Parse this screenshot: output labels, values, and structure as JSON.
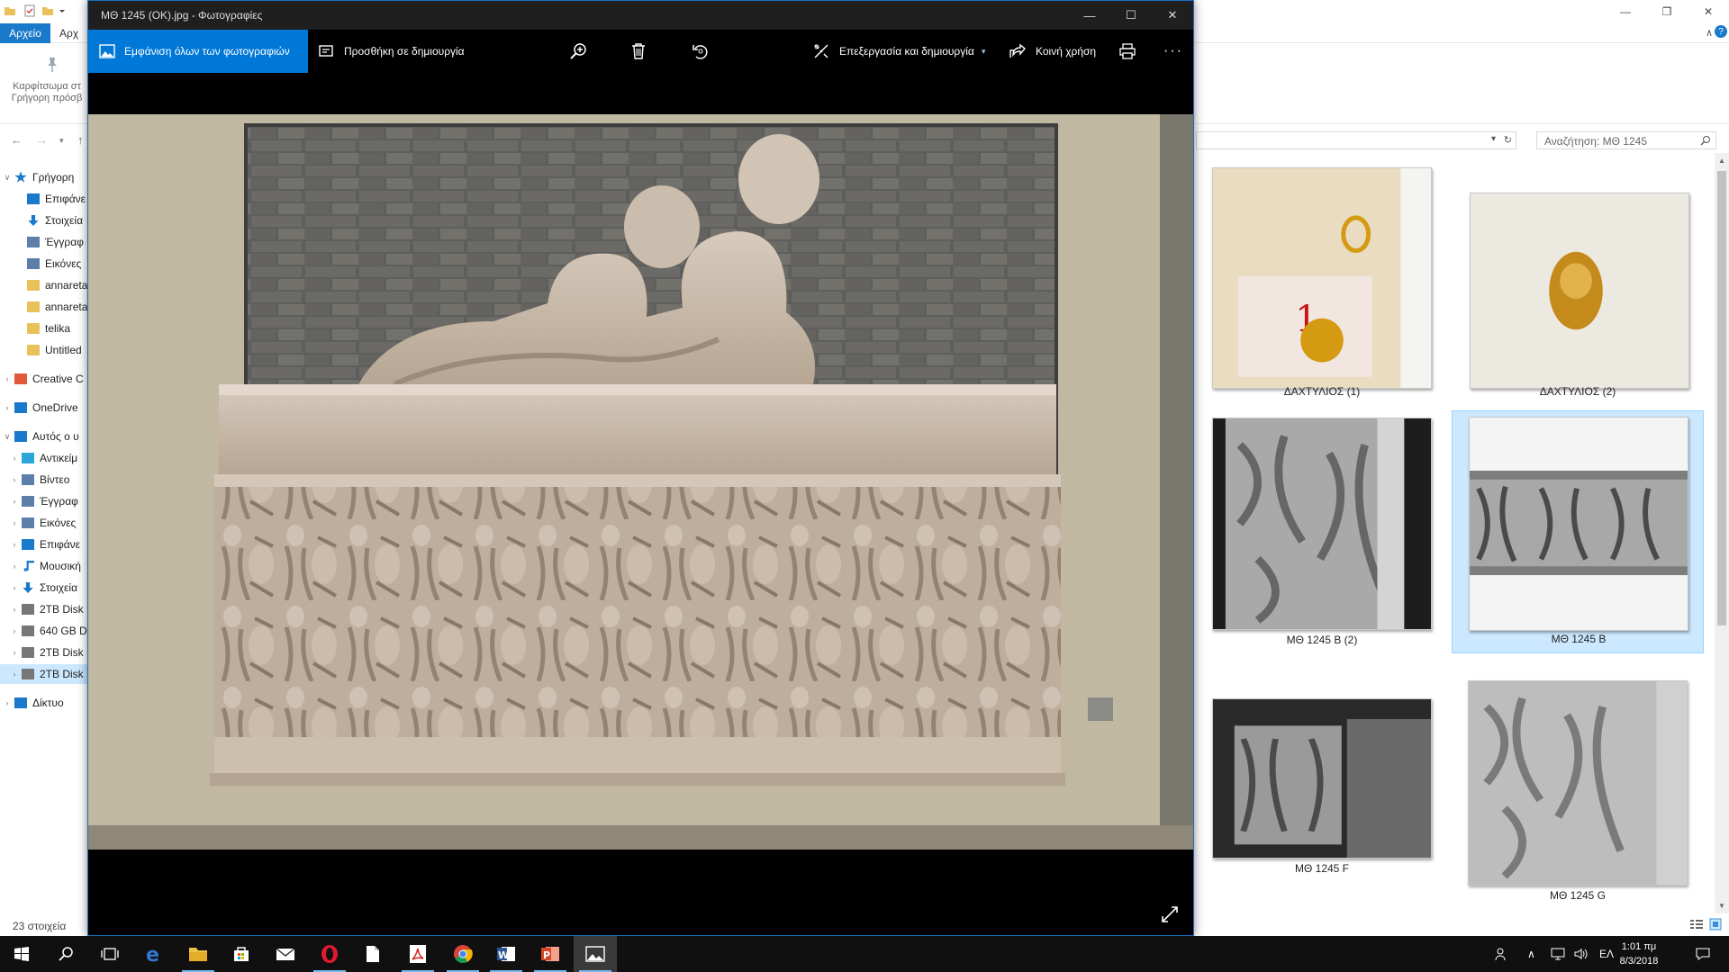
{
  "explorer": {
    "ribbon": {
      "file_tab": "Αρχείο",
      "home_tab": "Αρχ",
      "pin_label_line1": "Καρφίτσωμα στ",
      "pin_label_line2": "Γρήγορη πρόσβ"
    },
    "search_placeholder": "Αναζήτηση: ΜΘ 1245",
    "nav_items": [
      {
        "label": "Γρήγορη ",
        "chevron": "open",
        "icon": "star-icon",
        "color": "#1979ca"
      },
      {
        "label": "Επιφάνε",
        "chevron": "",
        "icon": "desktop-icon",
        "color": "#1979ca"
      },
      {
        "label": "Στοιχεία",
        "chevron": "",
        "icon": "download-icon",
        "color": "#1979ca"
      },
      {
        "label": "Έγγραφ",
        "chevron": "",
        "icon": "document-icon",
        "color": "#5b7fa8"
      },
      {
        "label": "Εικόνες",
        "chevron": "",
        "icon": "pictures-icon",
        "color": "#5b7fa8"
      },
      {
        "label": "annareta",
        "chevron": "",
        "icon": "folder-icon",
        "color": "#e8c15a"
      },
      {
        "label": "annareta",
        "chevron": "",
        "icon": "folder-icon",
        "color": "#e8c15a"
      },
      {
        "label": "telika",
        "chevron": "",
        "icon": "folder-icon",
        "color": "#e8c15a"
      },
      {
        "label": "Untitled",
        "chevron": "",
        "icon": "folder-icon",
        "color": "#e8c15a"
      },
      {
        "label": "Creative C",
        "chevron": "closed",
        "icon": "cloud-icon",
        "color": "#e05a3a"
      },
      {
        "label": "OneDrive",
        "chevron": "closed",
        "icon": "cloud-icon",
        "color": "#1979ca"
      },
      {
        "label": "Αυτός ο υ",
        "chevron": "open",
        "icon": "computer-icon",
        "color": "#1979ca"
      },
      {
        "label": "Αντικείμ",
        "chevron": "closed",
        "icon": "cube-icon",
        "color": "#2aa7d8"
      },
      {
        "label": "Βίντεο",
        "chevron": "closed",
        "icon": "video-icon",
        "color": "#5b7fa8"
      },
      {
        "label": "Έγγραφ",
        "chevron": "closed",
        "icon": "document-icon",
        "color": "#5b7fa8"
      },
      {
        "label": "Εικόνες",
        "chevron": "closed",
        "icon": "pictures-icon",
        "color": "#5b7fa8"
      },
      {
        "label": "Επιφάνε",
        "chevron": "closed",
        "icon": "desktop-icon",
        "color": "#1979ca"
      },
      {
        "label": "Μουσική",
        "chevron": "closed",
        "icon": "music-icon",
        "color": "#1979ca"
      },
      {
        "label": "Στοιχεία",
        "chevron": "closed",
        "icon": "download-icon",
        "color": "#1979ca"
      },
      {
        "label": "2TB Disk",
        "chevron": "closed",
        "icon": "drive-icon",
        "color": "#777777"
      },
      {
        "label": "640 GB D",
        "chevron": "closed",
        "icon": "drive-icon",
        "color": "#777777"
      },
      {
        "label": "2TB Disk",
        "chevron": "closed",
        "icon": "drive-icon",
        "color": "#777777"
      },
      {
        "label": "2TB Disk",
        "chevron": "closed",
        "icon": "drive-icon",
        "color": "#777777",
        "selected": true
      },
      {
        "label": "Δίκτυο",
        "chevron": "closed",
        "icon": "network-icon",
        "color": "#1979ca"
      }
    ],
    "status": "23 στοιχεία",
    "thumbnails": [
      {
        "caption": "ΔΑΧΤΥΛΙΟΣ (1)",
        "kind": "ring-tag"
      },
      {
        "caption": "ΔΑΧΤΥΛΙΟΣ (2)",
        "kind": "ring"
      },
      {
        "caption": "ΜΘ 1245 B (2)",
        "kind": "bw-relief-tall"
      },
      {
        "caption": "ΜΘ 1245 B",
        "kind": "bw-relief-wide",
        "selected": true
      },
      {
        "caption": "ΜΘ 1245 F",
        "kind": "bw-box"
      },
      {
        "caption": "ΜΘ 1245 G",
        "kind": "bw-relief-tall2"
      }
    ]
  },
  "photos": {
    "title": "ΜΘ 1245 (ΟΚ).jpg - Φωτογραφίες",
    "toolbar": {
      "see_all": "Εμφάνιση όλων των φωτογραφιών",
      "add_to_creation": "Προσθήκη σε δημιουργία",
      "edit_create": "Επεξεργασία και δημιουργία",
      "share": "Κοινή χρήση"
    },
    "colors": {
      "accent": "#0078d7",
      "background": "#000000"
    }
  },
  "taskbar": {
    "apps": [
      "start-icon",
      "search-icon",
      "task-view-icon",
      "edge-icon",
      "file-explorer-icon",
      "store-icon",
      "mail-icon",
      "opera-icon",
      "blank-document-icon",
      "acrobat-icon",
      "chrome-icon",
      "word-icon",
      "powerpoint-icon",
      "photos-icon"
    ],
    "language": "ΕΛ",
    "time": "1:01 πμ",
    "date": "8/3/2018"
  }
}
